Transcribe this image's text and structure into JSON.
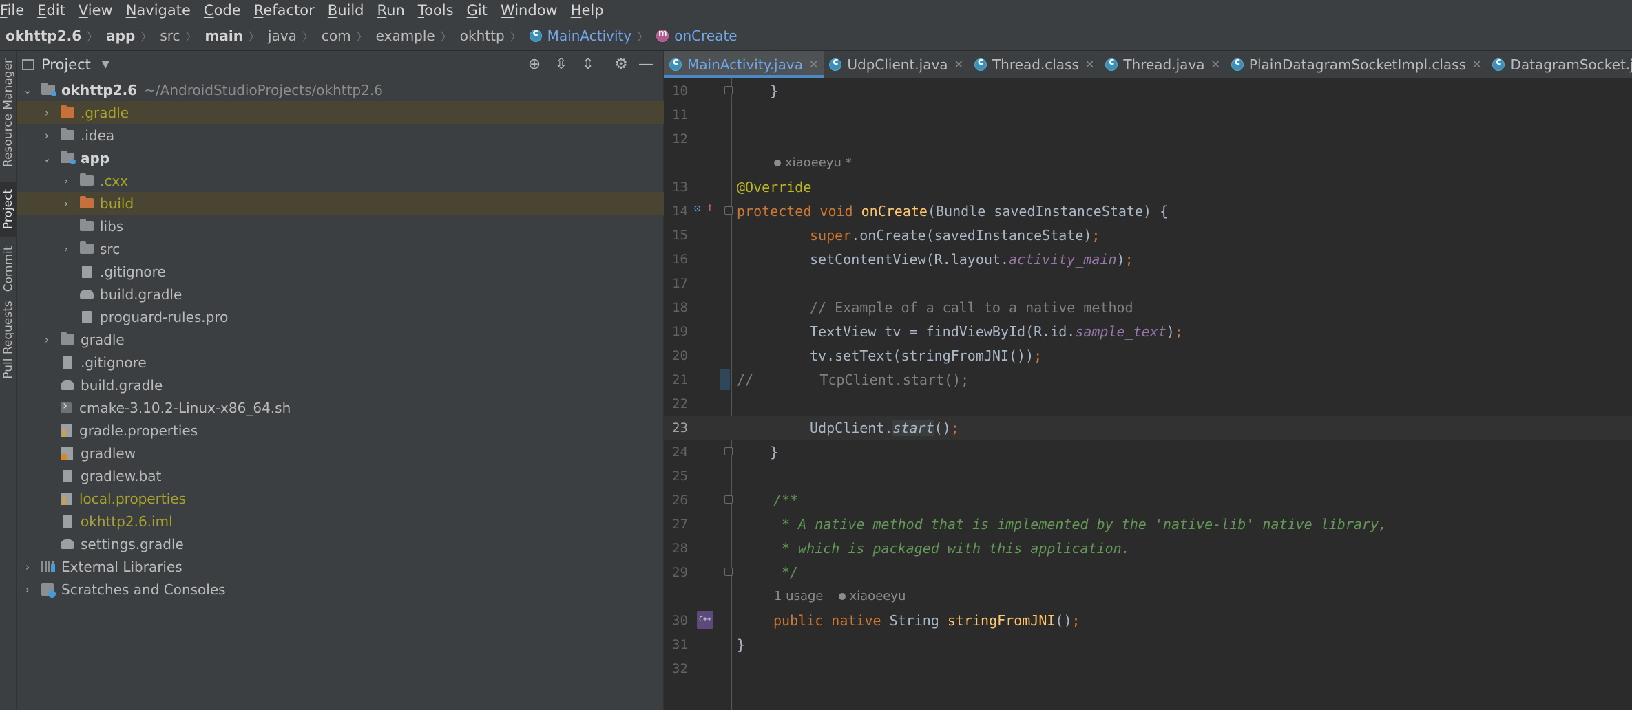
{
  "menu": [
    "File",
    "Edit",
    "View",
    "Navigate",
    "Code",
    "Refactor",
    "Build",
    "Run",
    "Tools",
    "Git",
    "Window",
    "Help"
  ],
  "menu_mnemonic": [
    "F",
    "E",
    "V",
    "N",
    "C",
    "R",
    "B",
    "R",
    "T",
    "G",
    "W",
    "H"
  ],
  "breadcrumb": [
    "okhttp2.6",
    "app",
    "src",
    "main",
    "java",
    "com",
    "example",
    "okhttp",
    "MainActivity",
    "onCreate"
  ],
  "side_tabs": [
    "Resource Manager",
    "Project",
    "Commit",
    "Pull Requests"
  ],
  "project": {
    "title": "Project",
    "tree": [
      {
        "name": "okhttp2.6",
        "path": "~/AndroidStudioProjects/okhttp2.6"
      },
      {
        "name": ".gradle"
      },
      {
        "name": ".idea"
      },
      {
        "name": "app"
      },
      {
        "name": ".cxx"
      },
      {
        "name": "build"
      },
      {
        "name": "libs"
      },
      {
        "name": "src"
      },
      {
        "name": ".gitignore"
      },
      {
        "name": "build.gradle"
      },
      {
        "name": "proguard-rules.pro"
      },
      {
        "name": "gradle"
      },
      {
        "name": ".gitignore"
      },
      {
        "name": "build.gradle"
      },
      {
        "name": "cmake-3.10.2-Linux-x86_64.sh"
      },
      {
        "name": "gradle.properties"
      },
      {
        "name": "gradlew"
      },
      {
        "name": "gradlew.bat"
      },
      {
        "name": "local.properties"
      },
      {
        "name": "okhttp2.6.iml"
      },
      {
        "name": "settings.gradle"
      },
      {
        "name": "External Libraries"
      },
      {
        "name": "Scratches and Consoles"
      }
    ]
  },
  "tabs": [
    "MainActivity.java",
    "UdpClient.java",
    "Thread.class",
    "Thread.java",
    "PlainDatagramSocketImpl.class",
    "DatagramSocket.java"
  ],
  "editor": {
    "line_numbers": [
      "10",
      "11",
      "12",
      "13",
      "14",
      "15",
      "16",
      "17",
      "18",
      "19",
      "20",
      "21",
      "22",
      "23",
      "24",
      "25",
      "26",
      "27",
      "28",
      "29",
      "30",
      "31",
      "32"
    ],
    "author_hint_1": "xiaoeeyu *",
    "usage_hint": "1 usage",
    "author_hint_2": "xiaoeeyu",
    "code": {
      "l10": "    }",
      "l13_ann": "@Override",
      "l14_kw": "protected void ",
      "l14_fn": "onCreate",
      "l14_rest": "(Bundle savedInstanceState) {",
      "l15_kw": "super",
      "l15_rest": ".onCreate(savedInstanceState)",
      "l15_semi": ";",
      "l16_a": "setContentView(R.layout.",
      "l16_field": "activity_main",
      "l16_b": ")",
      "l16_semi": ";",
      "l18": "// Example of a call to a native method",
      "l19_a": "TextView tv = findViewById(R.id.",
      "l19_field": "sample_text",
      "l19_b": ")",
      "l19_semi": ";",
      "l20_a": "tv.setText(stringFromJNI())",
      "l20_semi": ";",
      "l21": "//        TcpClient.start();",
      "l23_a": "UdpClient.",
      "l23_static": "start",
      "l23_b": "()",
      "l23_semi": ";",
      "l24": "    }",
      "l26": "/**",
      "l27": " * A native method that is implemented by the 'native-lib' native library,",
      "l28": " * which is packaged with this application.",
      "l29": " */",
      "l30_kw": "public native ",
      "l30_type": "String ",
      "l30_fn": "stringFromJNI",
      "l30_b": "()",
      "l30_semi": ";",
      "l31": "}"
    }
  },
  "colors": {
    "background": "#2b2b2b",
    "panel": "#3c3f41",
    "keyword": "#cc7832",
    "annotation": "#bbb529",
    "function": "#ffc66d",
    "doc_comment": "#629755",
    "highlight_row": "#4a4432"
  }
}
